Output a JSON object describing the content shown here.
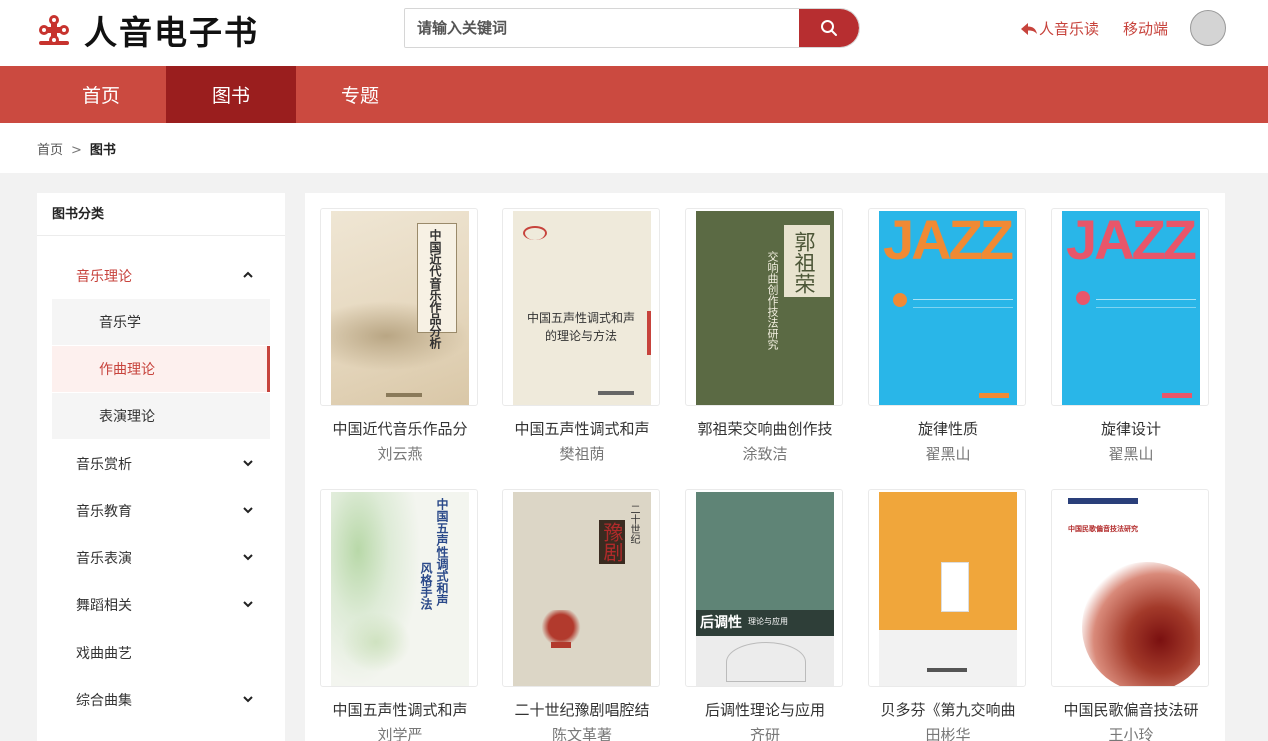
{
  "header": {
    "logo_icon": "seal-logo-icon",
    "logo_text": "人音电子书",
    "search_placeholder": "请输入关键词",
    "search_icon": "search-icon",
    "back_link": "人音乐读",
    "mobile_link": "移动端"
  },
  "nav": {
    "items": [
      {
        "label": "首页"
      },
      {
        "label": "图书"
      },
      {
        "label": "专题"
      }
    ],
    "active": "图书"
  },
  "breadcrumb": {
    "home": "首页",
    "separator": ">",
    "current": "图书"
  },
  "sidebar": {
    "title": "图书分类",
    "categories": [
      {
        "label": "音乐理论",
        "expanded": true
      },
      {
        "label": "音乐赏析"
      },
      {
        "label": "音乐教育"
      },
      {
        "label": "音乐表演"
      },
      {
        "label": "舞蹈相关"
      },
      {
        "label": "戏曲曲艺"
      },
      {
        "label": "综合曲集"
      }
    ],
    "subcategories": [
      {
        "label": "音乐学"
      },
      {
        "label": "作曲理论",
        "active": true
      },
      {
        "label": "表演理论"
      }
    ]
  },
  "books": [
    {
      "title": "中国近代音乐作品分",
      "author": "刘云燕",
      "cover_text": "中国近代音乐作品分析"
    },
    {
      "title": "中国五声性调式和声",
      "author": "樊祖荫",
      "cover_text": "中国五声性调式和声的理论与方法"
    },
    {
      "title": "郭祖荣交响曲创作技",
      "author": "涂致洁",
      "cover_title": "郭祖荣",
      "cover_sub": "交响曲创作技法研究"
    },
    {
      "title": "旋律性质",
      "author": "翟黑山",
      "cover_text": "JAZZ"
    },
    {
      "title": "旋律设计",
      "author": "翟黑山",
      "cover_text": "JAZZ"
    },
    {
      "title": "中国五声性调式和声",
      "author": "刘学严",
      "cover_text": "中国五声性调式和声风格手法"
    },
    {
      "title": "二十世纪豫剧唱腔结",
      "author": "陈文革著",
      "cover_top": "二十世纪",
      "cover_title": "豫剧"
    },
    {
      "title": "后调性理论与应用",
      "author": "齐研",
      "cover_title": "后调性",
      "cover_sub": "理论与应用"
    },
    {
      "title": "贝多芬《第九交响曲",
      "author": "田彬华",
      "cover_text": ""
    },
    {
      "title": "中国民歌偏音技法研",
      "author": "王小玲",
      "cover_text": "中国民歌偏音技法研究"
    }
  ],
  "colors": {
    "brand_red": "#cb4a40",
    "active_nav": "#9a1e1e",
    "accent": "#c7433c"
  }
}
